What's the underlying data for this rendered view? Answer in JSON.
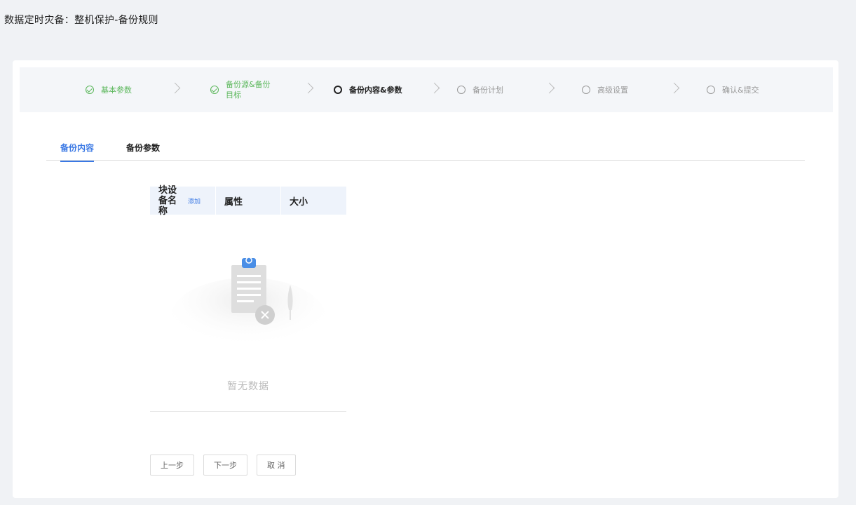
{
  "page": {
    "title": "数据定时灾备：整机保护-备份规则"
  },
  "steps": [
    {
      "label": "基本参数",
      "status": "done"
    },
    {
      "label": "备份源&备份目标",
      "status": "done"
    },
    {
      "label": "备份内容&参数",
      "status": "active"
    },
    {
      "label": "备份计划",
      "status": "pending"
    },
    {
      "label": "高级设置",
      "status": "pending"
    },
    {
      "label": "确认&提交",
      "status": "pending"
    }
  ],
  "tabs": [
    {
      "label": "备份内容",
      "active": true
    },
    {
      "label": "备份参数",
      "active": false
    }
  ],
  "table": {
    "columns": {
      "name": "块设备名称",
      "add_link": "添加",
      "attr": "属性",
      "size": "大小"
    },
    "empty_text": "暂无数据"
  },
  "buttons": {
    "prev": "上一步",
    "next": "下一步",
    "cancel": "取 消"
  },
  "colors": {
    "accent": "#3a78e4",
    "done": "#5bb75b",
    "background": "#f0f2f5"
  }
}
